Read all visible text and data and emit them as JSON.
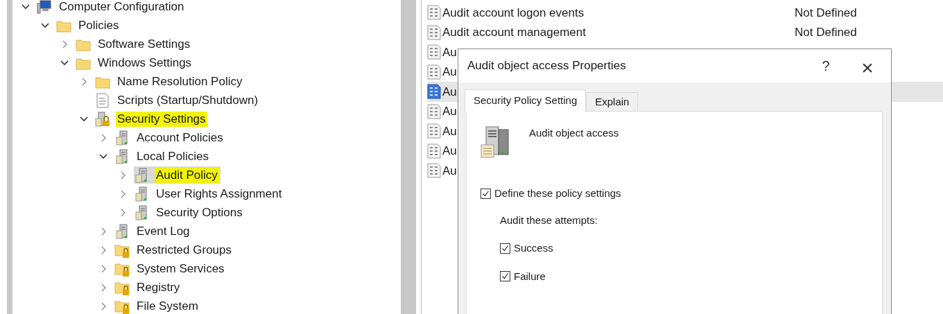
{
  "tree": [
    {
      "label": "Computer Configuration",
      "kind": "computer",
      "expanded": true,
      "highlighted": false,
      "selected": false,
      "children": [
        {
          "label": "Policies",
          "kind": "folder",
          "expanded": true,
          "highlighted": false,
          "selected": false,
          "children": [
            {
              "label": "Software Settings",
              "kind": "folder",
              "expanded": false,
              "highlighted": false,
              "selected": false
            },
            {
              "label": "Windows Settings",
              "kind": "folder",
              "expanded": true,
              "highlighted": false,
              "selected": false,
              "children": [
                {
                  "label": "Name Resolution Policy",
                  "kind": "folder",
                  "expanded": false,
                  "highlighted": false,
                  "selected": false
                },
                {
                  "label": "Scripts (Startup/Shutdown)",
                  "kind": "script",
                  "highlighted": false,
                  "selected": false
                },
                {
                  "label": "Security Settings",
                  "kind": "secure-server",
                  "expanded": true,
                  "highlighted": true,
                  "selected": false,
                  "children": [
                    {
                      "label": "Account Policies",
                      "kind": "server",
                      "expanded": false,
                      "highlighted": false,
                      "selected": false
                    },
                    {
                      "label": "Local Policies",
                      "kind": "server",
                      "expanded": true,
                      "highlighted": false,
                      "selected": false,
                      "children": [
                        {
                          "label": "Audit Policy",
                          "kind": "server",
                          "expanded": false,
                          "highlighted": true,
                          "selected": true
                        },
                        {
                          "label": "User Rights Assignment",
                          "kind": "server",
                          "expanded": false,
                          "highlighted": false,
                          "selected": false
                        },
                        {
                          "label": "Security Options",
                          "kind": "server",
                          "expanded": false,
                          "highlighted": false,
                          "selected": false
                        }
                      ]
                    },
                    {
                      "label": "Event Log",
                      "kind": "server",
                      "expanded": false,
                      "highlighted": false,
                      "selected": false
                    },
                    {
                      "label": "Restricted Groups",
                      "kind": "locked-folder",
                      "expanded": false,
                      "highlighted": false,
                      "selected": false
                    },
                    {
                      "label": "System Services",
                      "kind": "locked-folder",
                      "expanded": false,
                      "highlighted": false,
                      "selected": false
                    },
                    {
                      "label": "Registry",
                      "kind": "locked-folder",
                      "expanded": false,
                      "highlighted": false,
                      "selected": false
                    },
                    {
                      "label": "File System",
                      "kind": "locked-folder",
                      "expanded": false,
                      "highlighted": false,
                      "selected": false
                    }
                  ]
                }
              ]
            }
          ]
        }
      ]
    }
  ],
  "policies": [
    {
      "name": "Audit account logon events",
      "setting": "Not Defined",
      "selected": false
    },
    {
      "name": "Audit account management",
      "setting": "Not Defined",
      "selected": false
    },
    {
      "name": "Au",
      "selected": false
    },
    {
      "name": "Au",
      "selected": false
    },
    {
      "name": "Au",
      "selected": true
    },
    {
      "name": "Au",
      "selected": false
    },
    {
      "name": "Au",
      "selected": false
    },
    {
      "name": "Au",
      "selected": false
    },
    {
      "name": "Au",
      "selected": false
    }
  ],
  "dialog": {
    "title": "Audit object access Properties",
    "help": "?",
    "close": "×",
    "tabs": [
      {
        "label": "Security Policy Setting",
        "selected": true
      },
      {
        "label": "Explain",
        "selected": false
      }
    ],
    "policy_name": "Audit object access",
    "define": {
      "label": "Define these policy settings",
      "checked": true
    },
    "attempts_label": "Audit these attempts:",
    "attempts": [
      {
        "label": "Success",
        "checked": true
      },
      {
        "label": "Failure",
        "checked": true
      }
    ]
  }
}
